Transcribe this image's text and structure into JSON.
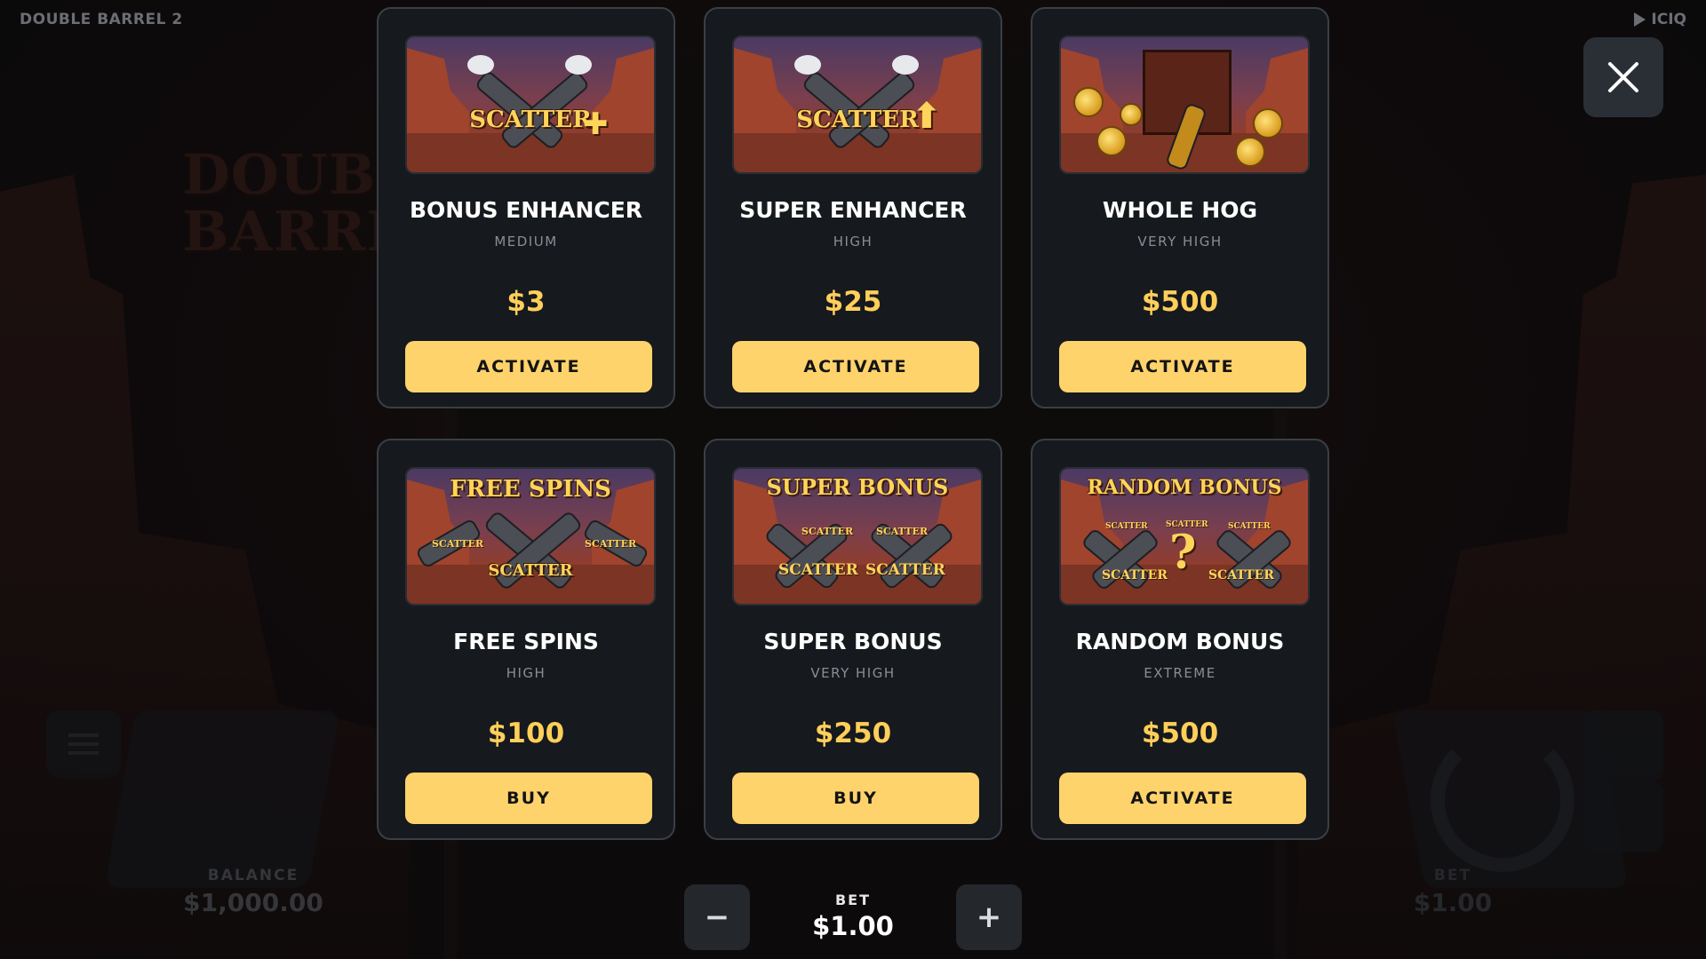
{
  "header": {
    "game_title": "DOUBLE BARREL 2",
    "brand": "ICIQ"
  },
  "background": {
    "logo_line1": "DOUBL",
    "logo_line2": "BARRE",
    "balance_label": "BALANCE",
    "balance_value": "$1,000.00",
    "bet_label_dim": "BET",
    "bet_value_dim": "$1.00"
  },
  "close_button": {
    "icon": "close-icon"
  },
  "features": [
    {
      "title": "BONUS ENHANCER",
      "volatility": "MEDIUM",
      "price": "$3",
      "button": "ACTIVATE",
      "art_text": "SCATTER",
      "art_badge": "plus-icon"
    },
    {
      "title": "SUPER ENHANCER",
      "volatility": "HIGH",
      "price": "$25",
      "button": "ACTIVATE",
      "art_text": "SCATTER",
      "art_badge": "arrow-up-icon"
    },
    {
      "title": "WHOLE HOG",
      "volatility": "VERY HIGH",
      "price": "$500",
      "button": "ACTIVATE",
      "art_text": "",
      "art_badge": "coins-cannon"
    },
    {
      "title": "FREE SPINS",
      "volatility": "HIGH",
      "price": "$100",
      "button": "BUY",
      "art_text": "FREE SPINS",
      "art_sub": "SCATTER"
    },
    {
      "title": "SUPER BONUS",
      "volatility": "VERY HIGH",
      "price": "$250",
      "button": "BUY",
      "art_text": "SUPER BONUS",
      "art_sub": "SCATTER"
    },
    {
      "title": "RANDOM BONUS",
      "volatility": "EXTREME",
      "price": "$500",
      "button": "ACTIVATE",
      "art_text": "RANDOM BONUS",
      "art_sub": "SCATTER",
      "art_mark": "?"
    }
  ],
  "bet_bar": {
    "minus": "−",
    "plus": "+",
    "label": "BET",
    "value": "$1.00"
  },
  "colors": {
    "accent_button": "#ffd36b",
    "price": "#ffcf5a",
    "card_bg": "#16191d"
  }
}
